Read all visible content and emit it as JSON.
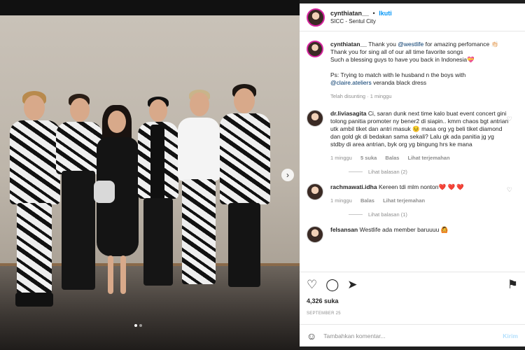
{
  "post": {
    "username": "cynthiatan__",
    "separator": "•",
    "follow_label": "Ikuti",
    "location": "SICC - Sentul City"
  },
  "caption": {
    "username": "cynthiatan__",
    "line1_pre": "Thank you ",
    "line1_mention": "@westlife",
    "line1_post": " for amazing perfomance 👏🏻",
    "line2": "Thank you for sing all of our all time favorite songs",
    "line3": "Such a blessing guys to have you back in Indonesia💝",
    "line4": "Ps: Trying to match with le husband n the boys with",
    "line5_mention": "@claire.ateliers",
    "line5_post": " veranda black dress",
    "meta": "Telah disunting · 1 minggu"
  },
  "comments": [
    {
      "username": "dr.liviasagita",
      "text": "Ci, saran dunk next time kalo buat event concert gini tolong panitia promoter ny bener2 di siapin.. kmrn chaos bgt antrian utk ambil tiket dan antri masuk 😣 masa org yg beli tiket diamond dan gold gk di bedakan sama sekali? Lalu gk ada panitia jg yg stdby di area antrian, byk org yg bingung hrs ke mana",
      "time": "1 minggu",
      "likes": "5 suka",
      "reply": "Balas",
      "translate": "Lihat terjemahan",
      "replies": "Lihat balasan (2)"
    },
    {
      "username": "rachmawati.idha",
      "text": "Kereen tdi mlm nonton❤️ ❤️ ❤️",
      "time": "1 minggu",
      "reply": "Balas",
      "translate": "Lihat terjemahan",
      "replies": "Lihat balasan (1)"
    },
    {
      "username": "felsansan",
      "text": "Westlife ada member baruuuu 🙆"
    }
  ],
  "icons": [
    "heart-icon",
    "comment-icon",
    "share-icon",
    "bookmark-icon",
    "emoji-icon",
    "chevron-right-icon"
  ],
  "likes_count": "4,326 suka",
  "date": "SEPTEMBER 25",
  "comment_input": {
    "placeholder": "Tambahkan komentar...",
    "send_label": "Kirim"
  }
}
